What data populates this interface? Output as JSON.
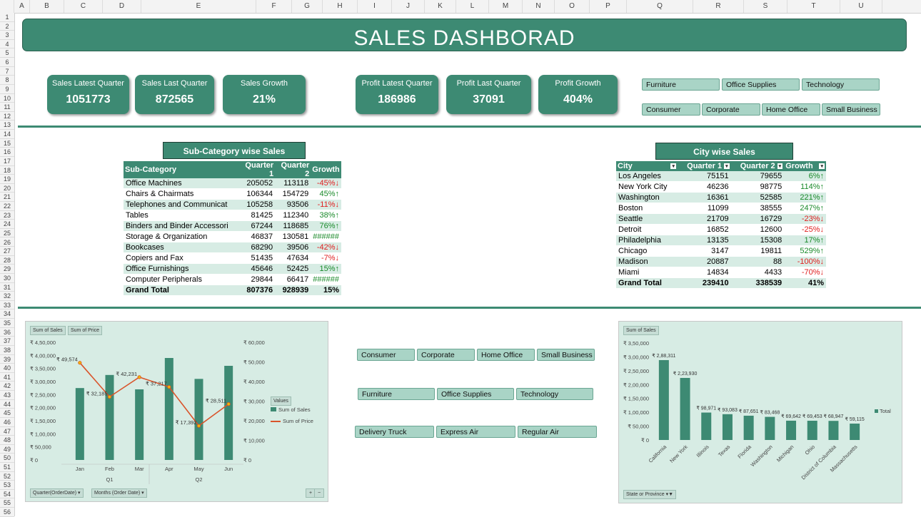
{
  "columns": [
    "A",
    "B",
    "C",
    "D",
    "E",
    "F",
    "G",
    "H",
    "I",
    "J",
    "K",
    "L",
    "M",
    "N",
    "O",
    "P",
    "Q",
    "R",
    "S",
    "T",
    "U"
  ],
  "title": "SALES DASHBORAD",
  "kpis": [
    {
      "label": "Sales Latest Quarter",
      "value": "1051773"
    },
    {
      "label": "Sales Last Quarter",
      "value": "872565"
    },
    {
      "label": "Sales Growth",
      "value": "21%"
    },
    {
      "label": "Profit Latest Quarter",
      "value": "186986"
    },
    {
      "label": "Profit Last Quarter",
      "value": "37091"
    },
    {
      "label": "Profit Growth",
      "value": "404%"
    }
  ],
  "slicers_top": {
    "category": [
      "Furniture",
      "Office Supplies",
      "Technology"
    ],
    "segment": [
      "Consumer",
      "Corporate",
      "Home Office",
      "Small Business"
    ]
  },
  "slicers_mid": {
    "segment": [
      "Consumer",
      "Corporate",
      "Home Office",
      "Small Business"
    ],
    "category": [
      "Furniture",
      "Office Supplies",
      "Technology"
    ],
    "ship": [
      "Delivery Truck",
      "Express Air",
      "Regular Air"
    ]
  },
  "subcat_table": {
    "title": "Sub-Category wise Sales",
    "headers": [
      "Sub-Category",
      "Quarter 1",
      "Quarter 2",
      "Growth"
    ],
    "rows": [
      {
        "name": "Office Machines",
        "q1": "205052",
        "q2": "113118",
        "g": "-45%",
        "dir": "down"
      },
      {
        "name": "Chairs & Chairmats",
        "q1": "106344",
        "q2": "154729",
        "g": "45%",
        "dir": "up"
      },
      {
        "name": "Telephones and Communicat",
        "q1": "105258",
        "q2": "93506",
        "g": "-11%",
        "dir": "down"
      },
      {
        "name": "Tables",
        "q1": "81425",
        "q2": "112340",
        "g": "38%",
        "dir": "up"
      },
      {
        "name": "Binders and Binder Accessori",
        "q1": "67244",
        "q2": "118685",
        "g": "76%",
        "dir": "up"
      },
      {
        "name": "Storage & Organization",
        "q1": "46837",
        "q2": "130581",
        "g": "######",
        "dir": "hash"
      },
      {
        "name": "Bookcases",
        "q1": "68290",
        "q2": "39506",
        "g": "-42%",
        "dir": "down"
      },
      {
        "name": "Copiers and Fax",
        "q1": "51435",
        "q2": "47634",
        "g": "-7%",
        "dir": "down"
      },
      {
        "name": "Office Furnishings",
        "q1": "45646",
        "q2": "52425",
        "g": "15%",
        "dir": "up"
      },
      {
        "name": "Computer Peripherals",
        "q1": "29844",
        "q2": "66417",
        "g": "######",
        "dir": "hash"
      }
    ],
    "total": {
      "name": "Grand Total",
      "q1": "807376",
      "q2": "928939",
      "g": "15%"
    }
  },
  "city_table": {
    "title": "City wise Sales",
    "headers": [
      "City",
      "Quarter 1",
      "Quarter 2",
      "Growth"
    ],
    "rows": [
      {
        "name": "Los Angeles",
        "q1": "75151",
        "q2": "79655",
        "g": "6%",
        "dir": "up"
      },
      {
        "name": "New York City",
        "q1": "46236",
        "q2": "98775",
        "g": "114%",
        "dir": "up"
      },
      {
        "name": "Washington",
        "q1": "16361",
        "q2": "52585",
        "g": "221%",
        "dir": "up"
      },
      {
        "name": "Boston",
        "q1": "11099",
        "q2": "38555",
        "g": "247%",
        "dir": "up"
      },
      {
        "name": "Seattle",
        "q1": "21709",
        "q2": "16729",
        "g": "-23%",
        "dir": "down"
      },
      {
        "name": "Detroit",
        "q1": "16852",
        "q2": "12600",
        "g": "-25%",
        "dir": "down"
      },
      {
        "name": "Philadelphia",
        "q1": "13135",
        "q2": "15308",
        "g": "17%",
        "dir": "up"
      },
      {
        "name": "Chicago",
        "q1": "3147",
        "q2": "19811",
        "g": "529%",
        "dir": "up"
      },
      {
        "name": "Madison",
        "q1": "20887",
        "q2": "88",
        "g": "-100%",
        "dir": "down"
      },
      {
        "name": "Miami",
        "q1": "14834",
        "q2": "4433",
        "g": "-70%",
        "dir": "down"
      }
    ],
    "total": {
      "name": "Grand Total",
      "q1": "239410",
      "q2": "338539",
      "g": "41%"
    }
  },
  "colors": {
    "accent": "#3d8a73",
    "line": "#d9542b",
    "marker": "#f2b600",
    "chart_bg": "#d7ece4"
  },
  "chart_data": [
    {
      "type": "bar",
      "pills": [
        "Sum of Sales",
        "Sum of Price"
      ],
      "categories": [
        "Jan",
        "Feb",
        "Mar",
        "Apr",
        "May",
        "Jun"
      ],
      "groups": [
        "Q1",
        "Q2"
      ],
      "left_ticks": [
        "₹ 4,50,000",
        "₹ 4,00,000",
        "₹ 3,50,000",
        "₹ 3,00,000",
        "₹ 2,50,000",
        "₹ 2,00,000",
        "₹ 1,50,000",
        "₹ 1,00,000",
        "₹ 50,000",
        "₹ 0"
      ],
      "right_ticks": [
        "₹ 60,000",
        "₹ 50,000",
        "₹ 40,000",
        "₹ 30,000",
        "₹ 20,000",
        "₹ 10,000",
        "₹ 0"
      ],
      "ylim": [
        0,
        450000
      ],
      "y2lim": [
        0,
        60000
      ],
      "series": [
        {
          "name": "Sum of Sales",
          "values": [
            275000,
            325000,
            270000,
            390000,
            310000,
            360000
          ]
        },
        {
          "name": "Sum of Price",
          "values": [
            49574,
            32185,
            42231,
            37217,
            17392,
            28511
          ],
          "labels": [
            "₹ 49,574",
            "₹ 32,185",
            "₹ 42,231",
            "₹ 37,217",
            "₹ 17,392",
            "₹ 28,511"
          ]
        }
      ],
      "legend_title": "Values",
      "filters": [
        "Quarter(OrderDate)",
        "Months (Order Date)"
      ]
    },
    {
      "type": "bar",
      "pills": [
        "Sum of Sales"
      ],
      "categories": [
        "California",
        "New York",
        "Illinois",
        "Texas",
        "Florida",
        "Washington",
        "Michigan",
        "Ohio",
        "District of Columbia",
        "Massachusetts"
      ],
      "values": [
        288311,
        223930,
        98971,
        93083,
        87651,
        83468,
        69642,
        69453,
        68947,
        59115
      ],
      "labels": [
        "₹ 2,88,311",
        "₹ 2,23,930",
        "₹ 98,971",
        "₹ 93,083",
        "₹ 87,651",
        "₹ 83,468",
        "₹ 69,642",
        "₹ 69,453",
        "₹ 68,947",
        "₹ 59,115"
      ],
      "left_ticks": [
        "₹ 3,50,000",
        "₹ 3,00,000",
        "₹ 2,50,000",
        "₹ 2,00,000",
        "₹ 1,50,000",
        "₹ 1,00,000",
        "₹ 50,000",
        "₹ 0"
      ],
      "ylim": [
        0,
        350000
      ],
      "legend": "Total",
      "filter": "State or Province"
    }
  ]
}
